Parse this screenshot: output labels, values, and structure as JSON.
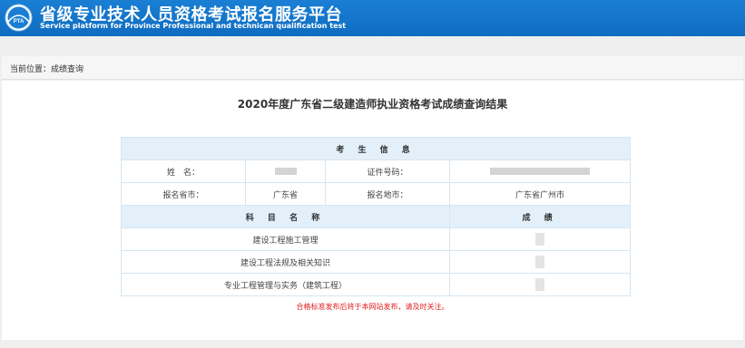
{
  "header": {
    "title": "省级专业技术人员资格考试报名服务平台",
    "subtitle": "Service platform for Province Professional and technican qualification test",
    "logo_text": "PTA",
    "bg_color": "#1275cb"
  },
  "breadcrumb": "当前位置：成绩查询",
  "result_title": "2020年度广东省二级建造师执业资格考试成绩查询结果",
  "candidate": {
    "section_title": "考 生 信 息",
    "name_label": "姓　名：",
    "id_label": "证件号码：",
    "province_label": "报名省市：",
    "province_value": "广东省",
    "city_label": "报名地市：",
    "city_value": "广东省广州市"
  },
  "scores": {
    "subject_header": "科 目 名 称",
    "score_header": "成 绩",
    "rows": [
      {
        "subject": "建设工程施工管理"
      },
      {
        "subject": "建设工程法规及相关知识"
      },
      {
        "subject": "专业工程管理与实务（建筑工程）"
      }
    ]
  },
  "notice": "合格标准发布后将于本网站发布，请及时关注。",
  "colors": {
    "notice": "#e02020",
    "table_header_bg": "#e3f0fa",
    "table_border": "#d5e6f2"
  }
}
